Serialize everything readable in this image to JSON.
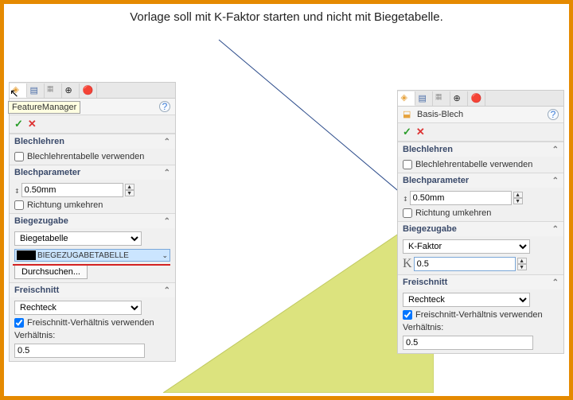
{
  "caption": "Vorlage soll mit K-Faktor starten und nicht mit Biegetabelle.",
  "tooltip": "FeatureManager",
  "leftPanel": {
    "title": "",
    "sections": {
      "blechlehren": {
        "title": "Blechlehren",
        "useTable": "Blechlehrentabelle verwenden"
      },
      "blechparameter": {
        "title": "Blechparameter",
        "thickness": "0.50mm",
        "reverse": "Richtung umkehren"
      },
      "biegezugabe": {
        "title": "Biegezugabe",
        "method": "Biegetabelle",
        "tableName": "BIEGEZUGABETABELLE",
        "browse": "Durchsuchen..."
      },
      "freischnitt": {
        "title": "Freischnitt",
        "shape": "Rechteck",
        "useRatio": "Freischnitt-Verhältnis verwenden",
        "ratioLabel": "Verhältnis:",
        "ratio": "0.5"
      }
    }
  },
  "rightPanel": {
    "title": "Basis-Blech",
    "sections": {
      "blechlehren": {
        "title": "Blechlehren",
        "useTable": "Blechlehrentabelle verwenden"
      },
      "blechparameter": {
        "title": "Blechparameter",
        "thickness": "0.50mm",
        "reverse": "Richtung umkehren"
      },
      "biegezugabe": {
        "title": "Biegezugabe",
        "method": "K-Faktor",
        "k": "0.5"
      },
      "freischnitt": {
        "title": "Freischnitt",
        "shape": "Rechteck",
        "useRatio": "Freischnitt-Verhältnis verwenden",
        "ratioLabel": "Verhältnis:",
        "ratio": "0.5"
      }
    }
  }
}
